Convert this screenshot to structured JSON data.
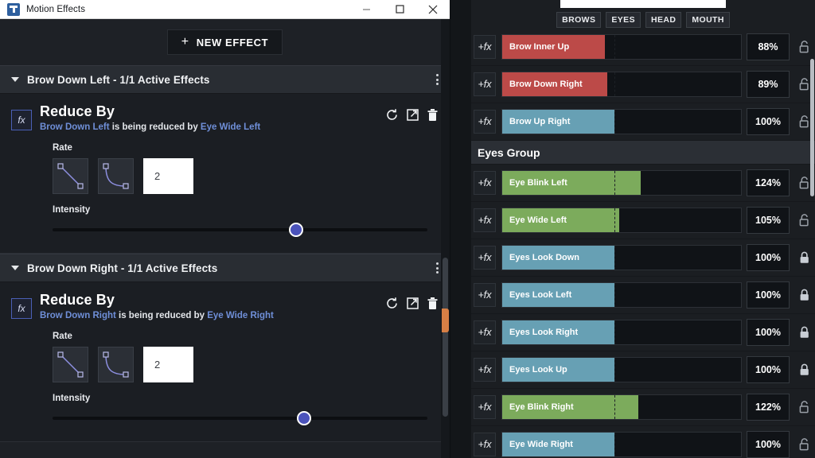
{
  "window": {
    "title": "Motion Effects",
    "app_icon": "app-logo-icon",
    "minimize": "minimize-icon",
    "maximize": "maximize-icon",
    "close": "close-icon"
  },
  "toolbar": {
    "new_effect_label": "NEW EFFECT",
    "plus_glyph": "+"
  },
  "effects": [
    {
      "section_title": "Brow Down Left - 1/1 Active Effects",
      "caret": "caret-down-icon",
      "menu_icon": "kebab-menu-icon",
      "fx_badge": "fx",
      "effect_title": "Reduce By",
      "desc_source": "Brow Down Left",
      "desc_middle": " is being reduced by ",
      "desc_target": "Eye Wide Left",
      "icons": {
        "reset": "reset-icon",
        "open": "open-external-icon",
        "delete": "trash-icon"
      },
      "rate_label": "Rate",
      "curve_linear": "curve-linear-icon",
      "curve_ease": "curve-ease-icon",
      "rate_value": "2",
      "intensity_label": "Intensity",
      "intensity_percent": 65
    },
    {
      "section_title": "Brow Down Right - 1/1 Active Effects",
      "caret": "caret-down-icon",
      "menu_icon": "kebab-menu-icon",
      "fx_badge": "fx",
      "effect_title": "Reduce By",
      "desc_source": "Brow Down Right",
      "desc_middle": " is being reduced by ",
      "desc_target": "Eye Wide Right",
      "icons": {
        "reset": "reset-icon",
        "open": "open-external-icon",
        "delete": "trash-icon"
      },
      "rate_label": "Rate",
      "curve_linear": "curve-linear-icon",
      "curve_ease": "curve-ease-icon",
      "rate_value": "2",
      "intensity_label": "Intensity",
      "intensity_percent": 67
    }
  ],
  "right_panel": {
    "tabs": [
      {
        "label": "BROWS"
      },
      {
        "label": "EYES"
      },
      {
        "label": "HEAD"
      },
      {
        "label": "MOUTH"
      }
    ],
    "add_fx_label": "+fx",
    "colors": {
      "red": "#bc4a48",
      "teal": "#67a0b4",
      "green": "#7cab5c"
    },
    "rows": [
      {
        "type": "track",
        "name": "Brow Inner Up",
        "value": "88%",
        "fill_percent": 43,
        "mark_percent": 47,
        "color": "red",
        "locked": false,
        "lock_icon": "lock-open-icon"
      },
      {
        "type": "track",
        "name": "Brow Down Right",
        "value": "89%",
        "fill_percent": 44,
        "mark_percent": 47,
        "color": "red",
        "locked": false,
        "lock_icon": "lock-open-icon"
      },
      {
        "type": "track",
        "name": "Brow Up Right",
        "value": "100%",
        "fill_percent": 47,
        "mark_percent": 47,
        "color": "teal",
        "locked": false,
        "lock_icon": "lock-open-icon"
      },
      {
        "type": "group",
        "name": "Eyes Group"
      },
      {
        "type": "track",
        "name": "Eye Blink Left",
        "value": "124%",
        "fill_percent": 58,
        "mark_percent": 47,
        "color": "green",
        "locked": false,
        "lock_icon": "lock-open-icon"
      },
      {
        "type": "track",
        "name": "Eye Wide Left",
        "value": "105%",
        "fill_percent": 49,
        "mark_percent": 47,
        "color": "green",
        "locked": false,
        "lock_icon": "lock-open-icon"
      },
      {
        "type": "track",
        "name": "Eyes Look Down",
        "value": "100%",
        "fill_percent": 47,
        "mark_percent": 47,
        "color": "teal",
        "locked": true,
        "lock_icon": "lock-closed-icon"
      },
      {
        "type": "track",
        "name": "Eyes Look Left",
        "value": "100%",
        "fill_percent": 47,
        "mark_percent": 47,
        "color": "teal",
        "locked": true,
        "lock_icon": "lock-closed-icon"
      },
      {
        "type": "track",
        "name": "Eyes Look Right",
        "value": "100%",
        "fill_percent": 47,
        "mark_percent": 47,
        "color": "teal",
        "locked": true,
        "lock_icon": "lock-closed-icon"
      },
      {
        "type": "track",
        "name": "Eyes Look Up",
        "value": "100%",
        "fill_percent": 47,
        "mark_percent": 47,
        "color": "teal",
        "locked": true,
        "lock_icon": "lock-closed-icon"
      },
      {
        "type": "track",
        "name": "Eye Blink Right",
        "value": "122%",
        "fill_percent": 57,
        "mark_percent": 47,
        "color": "green",
        "locked": false,
        "lock_icon": "lock-open-icon"
      },
      {
        "type": "track",
        "name": "Eye Wide Right",
        "value": "100%",
        "fill_percent": 47,
        "mark_percent": 47,
        "color": "teal",
        "locked": false,
        "lock_icon": "lock-open-icon"
      }
    ],
    "scrollbar": {
      "top_percent": 7,
      "height_percent": 32
    }
  }
}
